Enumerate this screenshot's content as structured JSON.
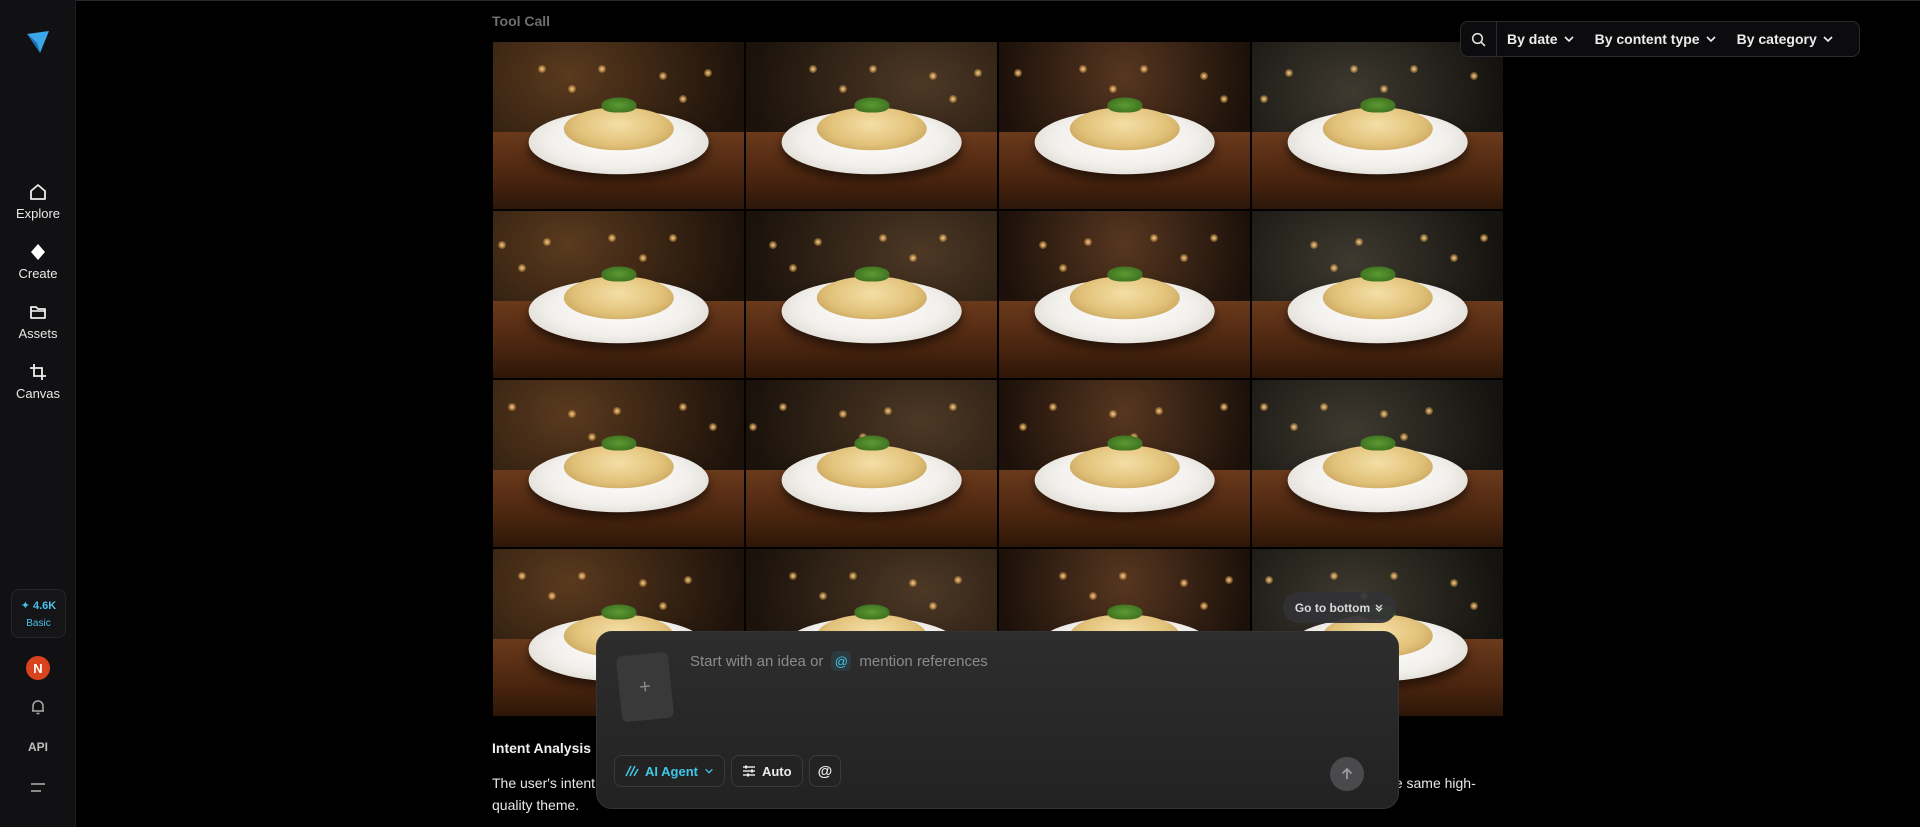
{
  "sidebar": {
    "items": [
      {
        "label": "Explore",
        "icon": "home-icon"
      },
      {
        "label": "Create",
        "icon": "diamond-icon"
      },
      {
        "label": "Assets",
        "icon": "folder-icon"
      },
      {
        "label": "Canvas",
        "icon": "crop-icon"
      }
    ],
    "credits": {
      "amount": "✦ 4.6K",
      "plan": "Basic"
    },
    "avatar_initial": "N",
    "api_label": "API"
  },
  "main": {
    "tool_call_label": "Tool Call",
    "go_bottom_label": "Go to bottom",
    "intent_title": "Intent Analysis",
    "intent_text": "The user's intent ... ography detailed in the provided prompt. This is a continuation of previous requests, indicating a need for more variations of the same high-quality theme."
  },
  "filters": {
    "by_date": "By date",
    "by_content_type": "By content type",
    "by_category": "By category"
  },
  "composer": {
    "placeholder_start": "Start with an idea or",
    "placeholder_at": "@",
    "placeholder_end": "mention references",
    "agent_label": "AI Agent",
    "mode_label": "Auto",
    "mention_symbol": "@"
  },
  "gallery": {
    "images": [
      {
        "alt": "pasta dish 1"
      },
      {
        "alt": "pasta dish 2"
      },
      {
        "alt": "pasta dish 3"
      },
      {
        "alt": "pasta dish 4"
      },
      {
        "alt": "pasta dish 5"
      },
      {
        "alt": "pasta dish 6"
      },
      {
        "alt": "pasta dish 7"
      },
      {
        "alt": "pasta dish 8"
      },
      {
        "alt": "pasta dish 9"
      },
      {
        "alt": "pasta dish 10"
      },
      {
        "alt": "pasta dish 11"
      },
      {
        "alt": "pasta dish 12"
      },
      {
        "alt": "pasta dish 13"
      },
      {
        "alt": "pasta dish 14"
      },
      {
        "alt": "pasta dish 15"
      },
      {
        "alt": "pasta dish 16"
      }
    ]
  },
  "colors": {
    "accent": "#3ec7e6",
    "avatar": "#d9431e",
    "background": "#000000"
  }
}
